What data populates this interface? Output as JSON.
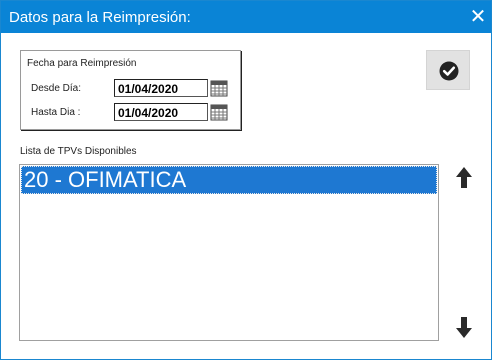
{
  "window": {
    "title": "Datos para la Reimpresión:",
    "close_symbol": "✕"
  },
  "date_group": {
    "caption": "Fecha para Reimpresión",
    "from_label": "Desde Día:",
    "from_value": "01/04/2020",
    "to_label": "Hasta Dia :",
    "to_value": "01/04/2020"
  },
  "tpv_list": {
    "label": "Lista de TPVs Disponibles",
    "items": [
      {
        "label": "20 - OFIMATICA",
        "selected": true
      }
    ]
  },
  "icons": {
    "confirm": "check-circle-icon",
    "calendar": "calendar-icon",
    "move_up": "arrow-up-icon",
    "move_down": "arrow-down-icon",
    "close": "close-icon"
  },
  "colors": {
    "titlebar": "#0a84d6",
    "selection": "#1e78d2"
  }
}
